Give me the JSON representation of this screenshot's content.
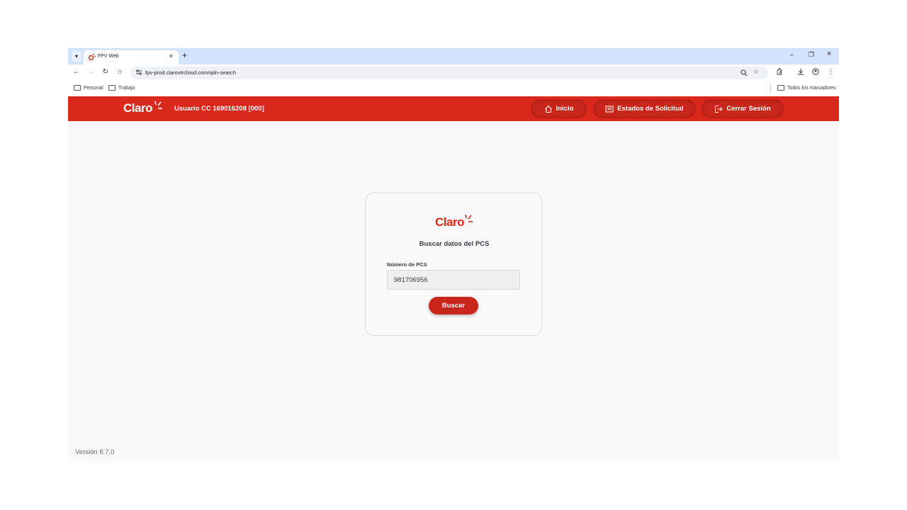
{
  "browser": {
    "tab_title": "FPV Web",
    "tab_close": "×",
    "new_tab": "+",
    "url": "fpv-prod.clarovtrcloud.com/qdn-search",
    "window_controls": {
      "minimize": "–",
      "restore": "❐",
      "close": "×"
    },
    "nav": {
      "back": "←",
      "forward": "→",
      "reload": "↻",
      "home": "⌂"
    },
    "bookmarks": [
      {
        "label": "Personal"
      },
      {
        "label": "Trabajo"
      }
    ],
    "all_bookmarks": "Todos los marcadores"
  },
  "header": {
    "logo_text": "Claro",
    "user_info": "Usuario CC 169016208 [000]",
    "nav": [
      {
        "label": "Inicio",
        "icon": "home-icon"
      },
      {
        "label": "Estados de Solicitud",
        "icon": "list-icon"
      },
      {
        "label": "Cerrar Sesión",
        "icon": "logout-icon"
      }
    ]
  },
  "search_card": {
    "logo_text": "Claro",
    "title": "Buscar datos del PCS",
    "field_label": "Número de PCS",
    "field_value": "981706956",
    "button_label": "Buscar"
  },
  "footer": {
    "version": "Versión 8.7.0"
  },
  "colors": {
    "brand_red": "#da291c",
    "button_red": "#c8261a",
    "browser_chrome": "#d3e3fd"
  }
}
